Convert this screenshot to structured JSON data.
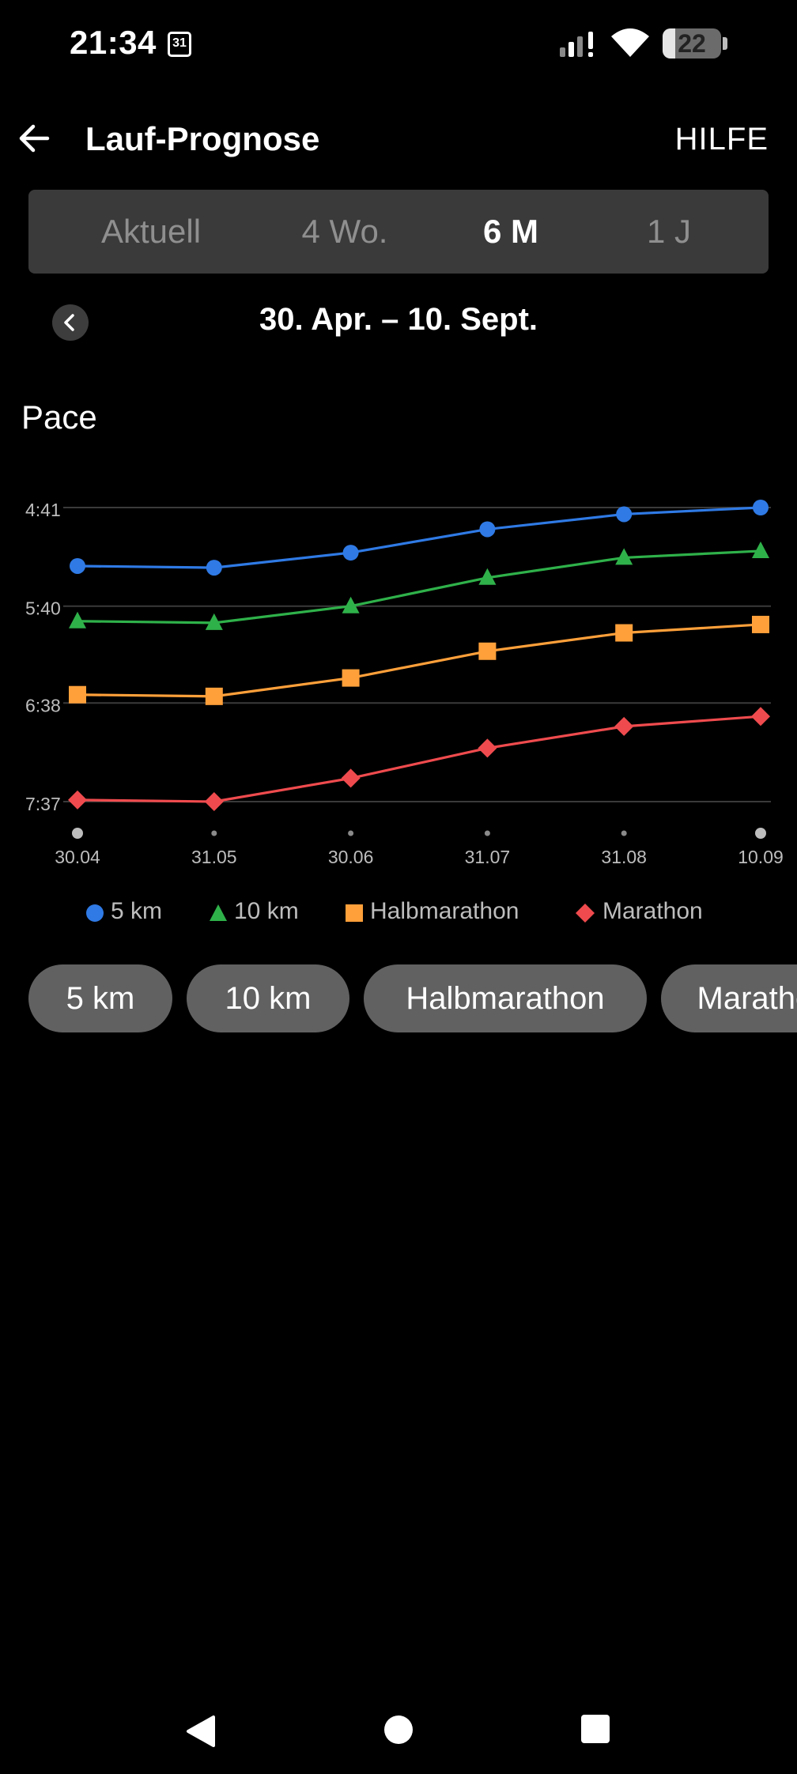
{
  "status_bar": {
    "time": "21:34",
    "calendar_day": "31",
    "battery_level": "22",
    "icons": [
      "calendar-icon",
      "signal-icon",
      "wifi-icon",
      "battery-icon"
    ]
  },
  "header": {
    "title": "Lauf-Prognose",
    "help_label": "HILFE",
    "back_icon": "arrow-left-icon"
  },
  "period_tabs": [
    {
      "label": "Aktuell",
      "active": false
    },
    {
      "label": "4 Wo.",
      "active": false
    },
    {
      "label": "6 M",
      "active": true
    },
    {
      "label": "1 J",
      "active": false
    }
  ],
  "date_range": {
    "label": "30. Apr. – 10. Sept.",
    "prev_icon": "chevron-left-icon"
  },
  "chart_title": "Pace",
  "chart_data": {
    "type": "line",
    "title": "Pace",
    "x": [
      "30.04",
      "31.05",
      "30.06",
      "31.07",
      "31.08",
      "10.09"
    ],
    "y_ticks": [
      "4:41",
      "5:40",
      "6:38",
      "7:37"
    ],
    "ylim_seconds": [
      281,
      457
    ],
    "y_inverted": true,
    "grid": true,
    "legend_position": "bottom",
    "series": [
      {
        "name": "5 km",
        "color": "#2f7ae5",
        "marker": "circle",
        "values": [
          "5:16",
          "5:17",
          "5:08",
          "4:54",
          "4:45",
          "4:41"
        ]
      },
      {
        "name": "10 km",
        "color": "#2fb14a",
        "marker": "triangle",
        "values": [
          "5:49",
          "5:50",
          "5:40",
          "5:23",
          "5:11",
          "5:07"
        ]
      },
      {
        "name": "Halbmarathon",
        "color": "#ffa03a",
        "marker": "square",
        "values": [
          "6:33",
          "6:34",
          "6:23",
          "6:07",
          "5:56",
          "5:51"
        ]
      },
      {
        "name": "Marathon",
        "color": "#ef4b4e",
        "marker": "diamond",
        "values": [
          "7:36",
          "7:37",
          "7:23",
          "7:05",
          "6:52",
          "6:46"
        ]
      }
    ]
  },
  "chips": [
    "5 km",
    "10 km",
    "Halbmarathon",
    "Marathon"
  ],
  "nav_bar": {
    "icons": [
      "back-triangle-icon",
      "home-circle-icon",
      "recents-square-icon"
    ]
  }
}
